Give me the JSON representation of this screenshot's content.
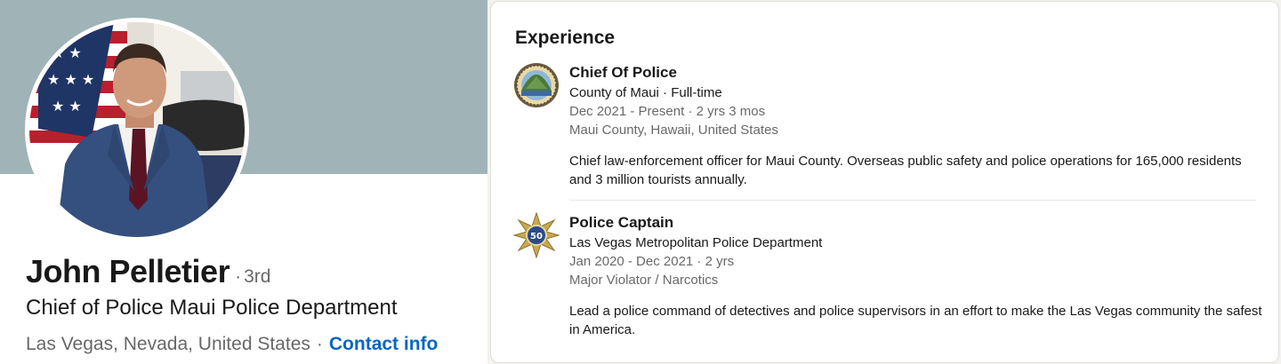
{
  "profile": {
    "name": "John Pelletier",
    "degree_sep": "·",
    "degree": "3rd",
    "headline": "Chief of Police Maui Police Department",
    "location": "Las Vegas, Nevada, United States",
    "location_sep": "·",
    "contact_label": "Contact info",
    "cover_color": "#a0b4b7",
    "avatar_icon": "profile-photo"
  },
  "experience": {
    "title": "Experience",
    "entries": [
      {
        "role": "Chief Of Police",
        "company": "County of Maui · Full-time",
        "dates": "Dec 2021 - Present · 2 yrs 3 mos",
        "location": "Maui County, Hawaii, United States",
        "description": "Chief law-enforcement officer for Maui County. Overseas public safety and police operations for 165,000 residents and 3 million tourists annually.",
        "logo_icon": "county-of-maui-seal"
      },
      {
        "role": "Police Captain",
        "company": "Las Vegas Metropolitan Police Department",
        "dates": "Jan 2020 - Dec 2021 · 2 yrs",
        "location": "Major Violator / Narcotics",
        "description": "Lead a police command of detectives and police supervisors in an effort to make the Las Vegas community the safest in America.",
        "logo_icon": "lvmpd-star-badge",
        "logo_text": "50"
      }
    ]
  },
  "colors": {
    "link": "#0a66c2",
    "text_primary": "#000000e6",
    "text_secondary": "#00000099"
  }
}
